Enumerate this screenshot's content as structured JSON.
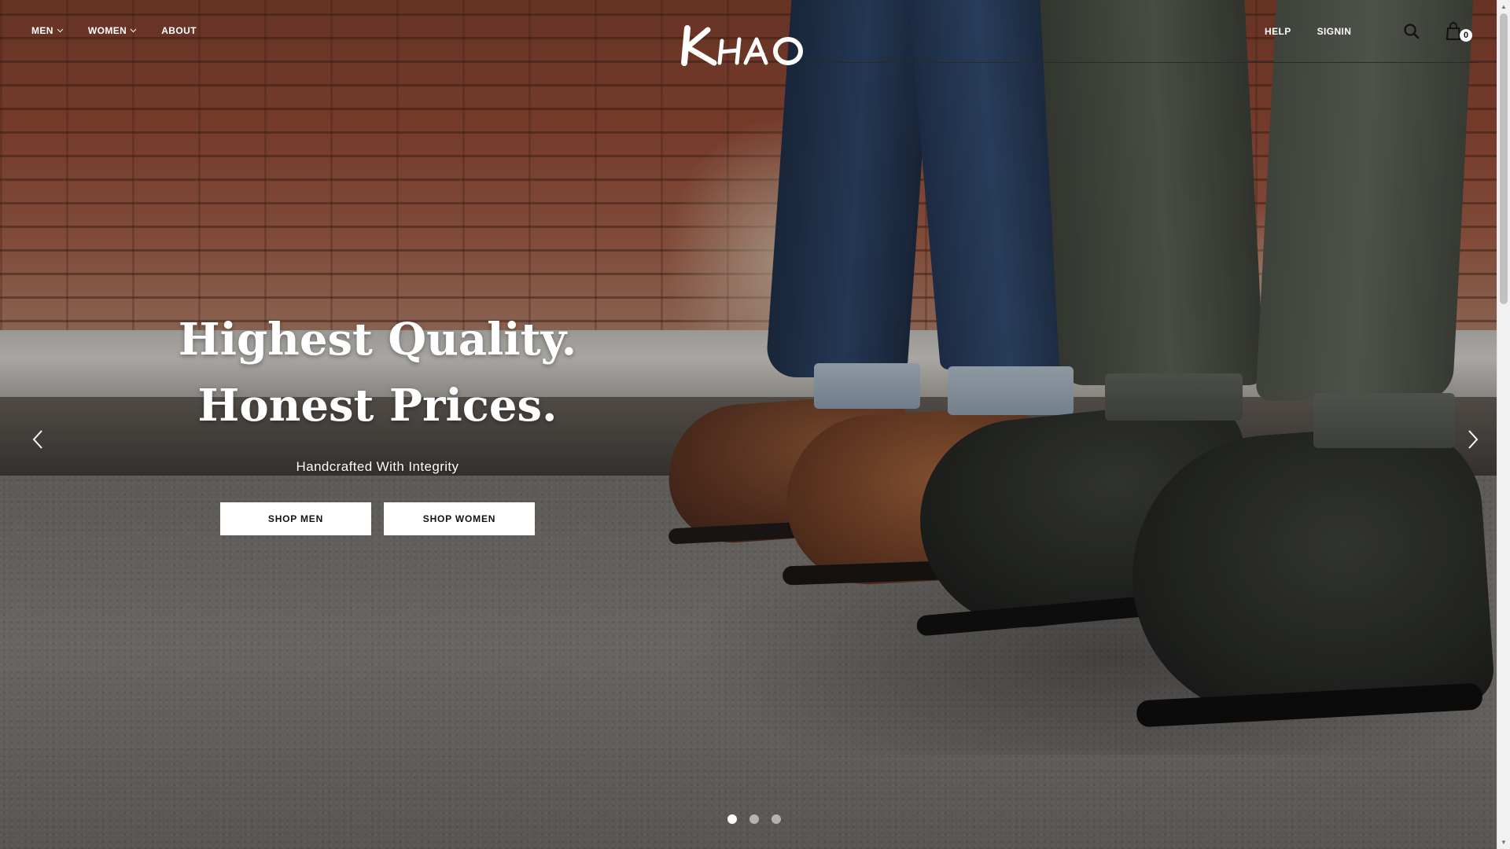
{
  "brand": {
    "logo_text": "KHAO"
  },
  "nav": {
    "left": [
      {
        "label": "MEN",
        "has_dropdown": true
      },
      {
        "label": "WOMEN",
        "has_dropdown": true
      },
      {
        "label": "ABOUT",
        "has_dropdown": false
      }
    ],
    "right": [
      {
        "label": "HELP"
      },
      {
        "label": "SIGNIN"
      }
    ],
    "search_icon": "search-icon",
    "cart": {
      "icon": "shopping-bag-icon",
      "count": "0"
    }
  },
  "hero": {
    "headline_line1": "Highest Quality.",
    "headline_line2": "Honest Prices.",
    "tagline": "Handcrafted With Integrity",
    "cta_primary": "SHOP MEN",
    "cta_secondary": "SHOP WOMEN"
  },
  "slider": {
    "prev_icon": "chevron-left-icon",
    "next_icon": "chevron-right-icon",
    "slide_count": 3,
    "active_slide": 1
  },
  "colors": {
    "text_on_hero": "#ffffff",
    "button_bg": "#ffffff",
    "button_text": "#111111"
  }
}
